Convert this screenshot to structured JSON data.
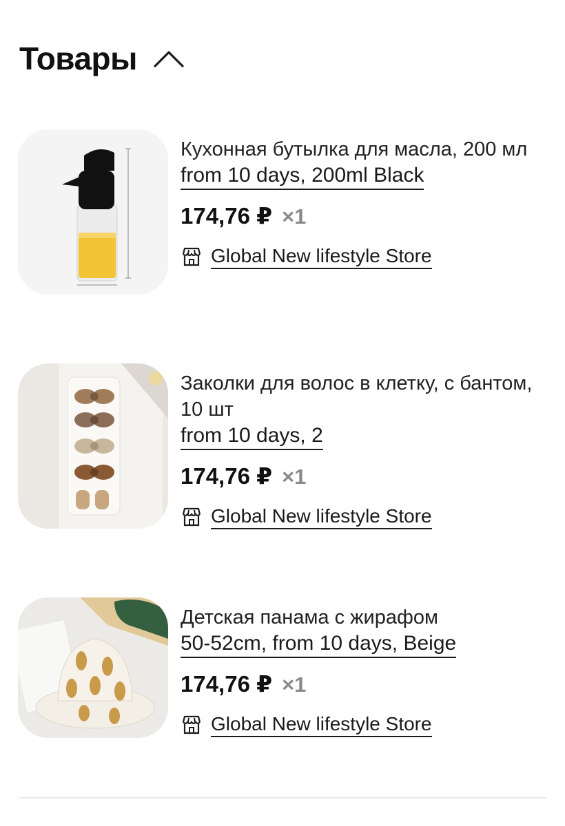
{
  "section": {
    "title": "Товары"
  },
  "products": [
    {
      "title": "Кухонная бутылка для масла, 200 мл",
      "variant": "from 10 days, 200ml Black",
      "price": "174,76 ₽",
      "qty": "×1",
      "store": "Global New lifestyle Store"
    },
    {
      "title": "Заколки для волос в клетку, с бантом, 10 шт",
      "variant": "from 10 days, 2",
      "price": "174,76 ₽",
      "qty": "×1",
      "store": "Global New lifestyle Store"
    },
    {
      "title": "Детская панама с жирафом",
      "variant": "50-52cm, from 10 days, Beige",
      "price": "174,76 ₽",
      "qty": "×1",
      "store": "Global New lifestyle Store"
    }
  ],
  "colors": {
    "text": "#111111",
    "qty": "#8a8a8a",
    "divider": "#e6e6e6"
  }
}
